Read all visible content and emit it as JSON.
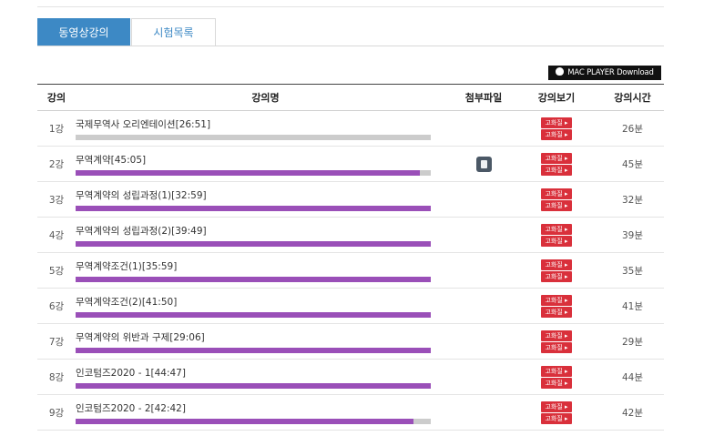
{
  "tabs": [
    {
      "label": "동영상강의",
      "active": true
    },
    {
      "label": "시험목록",
      "active": false
    }
  ],
  "mac_button": {
    "label": "MAC PLAYER Download"
  },
  "table": {
    "headers": [
      "강의",
      "강의명",
      "첨부파일",
      "강의보기",
      "강의시간"
    ],
    "rows": [
      {
        "num": "1강",
        "title": "국제무역사 오리엔테이션[26:51]",
        "progress": 0.0,
        "attachment": false,
        "btn1": "고화질 ▸",
        "btn2": "고화질 ▸",
        "minutes": "26분"
      },
      {
        "num": "2강",
        "title": "무역계약[45:05]",
        "progress": 0.97,
        "attachment": true,
        "btn1": "고화질 ▸",
        "btn2": "고화질 ▸",
        "minutes": "45분"
      },
      {
        "num": "3강",
        "title": "무역계약의 성립과정(1)[32:59]",
        "progress": 1.0,
        "attachment": false,
        "btn1": "고화질 ▸",
        "btn2": "고화질 ▸",
        "minutes": "32분"
      },
      {
        "num": "4강",
        "title": "무역계약의 성립과정(2)[39:49]",
        "progress": 1.0,
        "attachment": false,
        "btn1": "고화질 ▸",
        "btn2": "고화질 ▸",
        "minutes": "39분"
      },
      {
        "num": "5강",
        "title": "무역계약조건(1)[35:59]",
        "progress": 1.0,
        "attachment": false,
        "btn1": "고화질 ▸",
        "btn2": "고화질 ▸",
        "minutes": "35분"
      },
      {
        "num": "6강",
        "title": "무역계약조건(2)[41:50]",
        "progress": 1.0,
        "attachment": false,
        "btn1": "고화질 ▸",
        "btn2": "고화질 ▸",
        "minutes": "41분"
      },
      {
        "num": "7강",
        "title": "무역계약의 위반과 구제[29:06]",
        "progress": 1.0,
        "attachment": false,
        "btn1": "고화질 ▸",
        "btn2": "고화질 ▸",
        "minutes": "29분"
      },
      {
        "num": "8강",
        "title": "인코텀즈2020 - 1[44:47]",
        "progress": 1.0,
        "attachment": false,
        "btn1": "고화질 ▸",
        "btn2": "고화질 ▸",
        "minutes": "44분"
      },
      {
        "num": "9강",
        "title": "인코텀즈2020 - 2[42:42]",
        "progress": 0.95,
        "attachment": false,
        "btn1": "고화질 ▸",
        "btn2": "고화질 ▸",
        "minutes": "42분"
      }
    ]
  },
  "colors": {
    "accent_blue": "#3d89c5",
    "progress_purple": "#9a4fb8",
    "play_red": "#d9303b"
  }
}
